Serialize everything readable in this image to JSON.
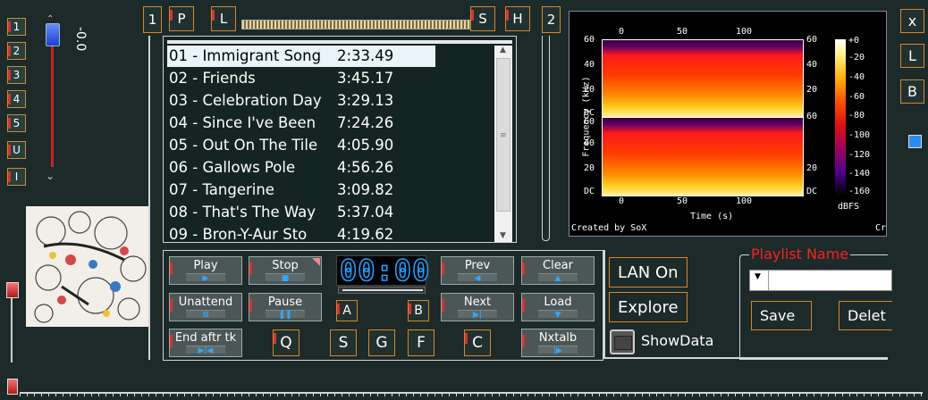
{
  "left_panel": {
    "number_buttons": [
      "1",
      "2",
      "3",
      "4",
      "5",
      "U",
      "I"
    ],
    "volume_readout": "-0.0"
  },
  "top_bar": {
    "group1_label": "1",
    "p_label": "P",
    "l_label": "L",
    "s_label": "S",
    "h_label": "H",
    "group2_label": "2"
  },
  "playlist": {
    "tracks": [
      {
        "title": "01 - Immigrant Song",
        "duration": "2:33.49",
        "selected": true
      },
      {
        "title": "02 - Friends",
        "duration": "3:45.17"
      },
      {
        "title": "03 - Celebration Day",
        "duration": "3:29.13"
      },
      {
        "title": "04 - Since I've Been",
        "duration": "7:24.26"
      },
      {
        "title": "05 - Out On The Tile",
        "duration": "4:05.90"
      },
      {
        "title": "06 - Gallows Pole",
        "duration": "4:56.26"
      },
      {
        "title": "07 - Tangerine",
        "duration": "3:09.82"
      },
      {
        "title": "08 - That's The Way",
        "duration": "5:37.04"
      },
      {
        "title": "09 - Bron-Y-Aur Sto",
        "duration": "4:19.62"
      }
    ]
  },
  "spectrogram": {
    "x_ticks": [
      "0",
      "50",
      "100"
    ],
    "y_ticks_top": [
      "60",
      "40",
      "20"
    ],
    "y_ticks_bottom": [
      "60",
      "40",
      "20",
      "DC"
    ],
    "y_tick_dc_top": "DC",
    "ylabel": "Frequency (kHz)",
    "xlabel": "Time (s)",
    "colorbar_ticks": [
      "+0",
      "-20",
      "-40",
      "-60",
      "-80",
      "-100",
      "-120",
      "-140",
      "-160"
    ],
    "colorbar_unit": "dBFS",
    "credit": "Created by SoX",
    "credit_right": "Cr"
  },
  "right_buttons": {
    "x": "x",
    "l": "L",
    "b": "B"
  },
  "controls": {
    "play": "Play",
    "stop": "Stop",
    "prev": "Prev",
    "clear": "Clear",
    "unattend": "Unattend",
    "pause": "Pause",
    "next": "Next",
    "load": "Load",
    "end_after": "End aftr tk",
    "nxtalb": "Nxtalb",
    "time_display": "00:00",
    "a": "A",
    "b": "B",
    "q": "Q",
    "s": "S",
    "g": "G",
    "f": "F",
    "c": "C"
  },
  "lan": {
    "lan_on": "LAN On",
    "explore": "Explore",
    "show_data": "ShowData"
  },
  "playlist_name": {
    "label": "Playlist Name",
    "save": "Save",
    "delete": "Delet"
  },
  "colors": {
    "accent": "#d6862a",
    "marker": "#e0302a",
    "digits": "#1aa0ff",
    "playlist_name": "#ff2020"
  }
}
